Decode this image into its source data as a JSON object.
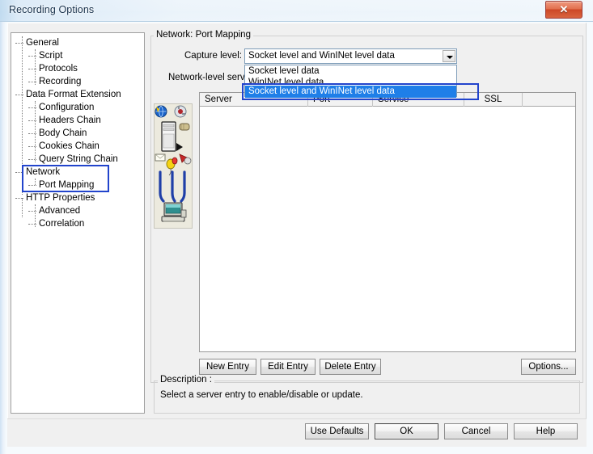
{
  "window": {
    "title": "Recording Options",
    "close_icon": "close-x-icon"
  },
  "tree": {
    "nodes": [
      {
        "label": "General",
        "level": 0
      },
      {
        "label": "Script",
        "level": 1
      },
      {
        "label": "Protocols",
        "level": 1
      },
      {
        "label": "Recording",
        "level": 1
      },
      {
        "label": "Data Format Extension",
        "level": 0
      },
      {
        "label": "Configuration",
        "level": 1
      },
      {
        "label": "Headers Chain",
        "level": 1
      },
      {
        "label": "Body Chain",
        "level": 1
      },
      {
        "label": "Cookies Chain",
        "level": 1
      },
      {
        "label": "Query String Chain",
        "level": 1
      },
      {
        "label": "Network",
        "level": 0
      },
      {
        "label": "Port Mapping",
        "level": 1
      },
      {
        "label": "HTTP Properties",
        "level": 0
      },
      {
        "label": "Advanced",
        "level": 1
      },
      {
        "label": "Correlation",
        "level": 1
      }
    ]
  },
  "main": {
    "group_title": "Network: Port Mapping",
    "capture_level_label": "Capture level:",
    "network_level_label": "Network-level server",
    "combo": {
      "value": "Socket level and WinINet level data",
      "arrow_icon": "chevron-down-icon",
      "options": [
        "Socket level data",
        "WinINet level data",
        "Socket level and WinINet level data"
      ],
      "selected_option": "Socket level and WinINet level data"
    },
    "table": {
      "columns": [
        "Server",
        "Port",
        "Service",
        "SSL"
      ],
      "rows": []
    },
    "entry_buttons": {
      "new": "New Entry",
      "edit": "Edit Entry",
      "delete": "Delete Entry",
      "options": "Options..."
    },
    "illustration_icon": "network-server-to-client-illustration"
  },
  "description": {
    "legend": "Description :",
    "text": "Select a server entry to enable/disable or update."
  },
  "dialog_buttons": {
    "use_defaults": "Use Defaults",
    "ok": "OK",
    "cancel": "Cancel",
    "help": "Help"
  },
  "colors": {
    "highlight": "#1f7fe8",
    "annotation": "#2244cc",
    "close_button": "#cd4827",
    "dialog_face": "#f0f0f0"
  }
}
